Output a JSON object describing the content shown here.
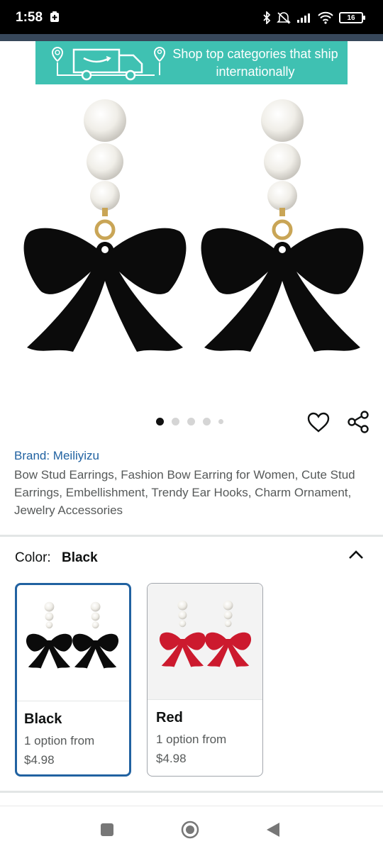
{
  "status_bar": {
    "time": "1:58",
    "battery": "16",
    "icons": [
      "notification-icon",
      "bluetooth-icon",
      "mute-icon",
      "signal-icon",
      "wifi-icon",
      "battery-icon"
    ]
  },
  "banner": {
    "text": "Shop top categories that ship internationally"
  },
  "carousel": {
    "total_dots": 5,
    "active_index": 0
  },
  "product": {
    "brand": "Brand: Meiliyizu",
    "title": "Bow Stud Earrings, Fashion Bow Earring for Women, Cute Stud Earrings, Embellishment, Trendy Ear Hooks, Charm Ornament, Jewelry Accessories"
  },
  "color_selector": {
    "label": "Color:",
    "selected_value": "Black",
    "options": [
      {
        "name": "Black",
        "options_text": "1 option from",
        "price": "$4.98",
        "bow_color": "#0b0b0b",
        "selected": true
      },
      {
        "name": "Red",
        "options_text": "1 option from",
        "price": "$4.98",
        "bow_color": "#cc1a2e",
        "selected": false
      }
    ]
  },
  "colors": {
    "banner_bg": "#3fc1b2",
    "link_blue": "#2162a1",
    "header_strip": "#37475a"
  },
  "nav": {
    "icons": [
      "recent-apps-icon",
      "home-icon",
      "back-icon"
    ]
  }
}
